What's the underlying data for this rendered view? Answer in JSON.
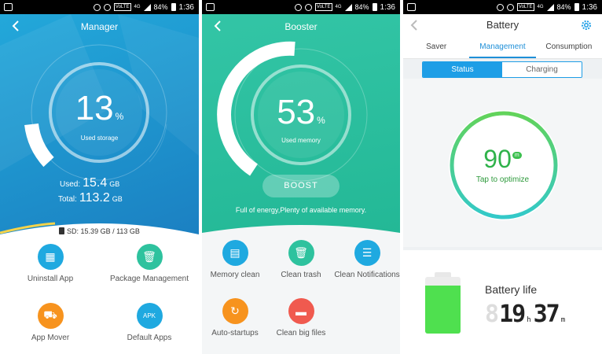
{
  "status_bar": {
    "battery": "84%",
    "time": "1:36",
    "network": "4G",
    "lte": "VoLTE"
  },
  "manager": {
    "title": "Manager",
    "percent": "13",
    "percent_sign": "%",
    "percent_label": "Used storage",
    "used_label": "Used:",
    "used_value": "15.4",
    "used_unit": "GB",
    "total_label": "Total:",
    "total_value": "113.2",
    "total_unit": "GB",
    "sd_text": "SD: 15.39 GB / 113 GB",
    "items": [
      {
        "label": "Uninstall App",
        "icon": "apps-icon",
        "color": "#1fa9e0"
      },
      {
        "label": "Package Management",
        "icon": "trash-icon",
        "color": "#2ec29e"
      },
      {
        "label": "App Mover",
        "icon": "truck-icon",
        "color": "#f7931e"
      },
      {
        "label": "Default Apps",
        "icon": "apk-icon",
        "color": "#1fa9e0"
      }
    ]
  },
  "booster": {
    "title": "Booster",
    "percent": "53",
    "percent_sign": "%",
    "percent_label": "Used memory",
    "boost_label": "BOOST",
    "message": "Full of energy,Plenty of available memory.",
    "items": [
      {
        "label": "Memory clean",
        "icon": "sd-card-icon",
        "color": "#1fa9e0"
      },
      {
        "label": "Clean trash",
        "icon": "trash-icon",
        "color": "#2ec29e"
      },
      {
        "label": "Clean Notifications",
        "icon": "chat-icon",
        "color": "#1fa9e0"
      },
      {
        "label": "Auto-startups",
        "icon": "refresh-icon",
        "color": "#f7931e"
      },
      {
        "label": "Clean big files",
        "icon": "folder-icon",
        "color": "#f05a4f"
      }
    ]
  },
  "battery": {
    "title": "Battery",
    "tabs": [
      "Saver",
      "Management",
      "Consumption"
    ],
    "active_tab": "Management",
    "segments": [
      "Status",
      "Charging"
    ],
    "score": "90",
    "score_unit": "m",
    "tap_text": "Tap to optimize",
    "life_label": "Battery life",
    "hours": "19",
    "hours_unit": "h",
    "minutes": "37",
    "minutes_unit": "m",
    "battery_level_fraction": 0.85,
    "accent": "#1e8fd8",
    "green": "#33c24a"
  }
}
